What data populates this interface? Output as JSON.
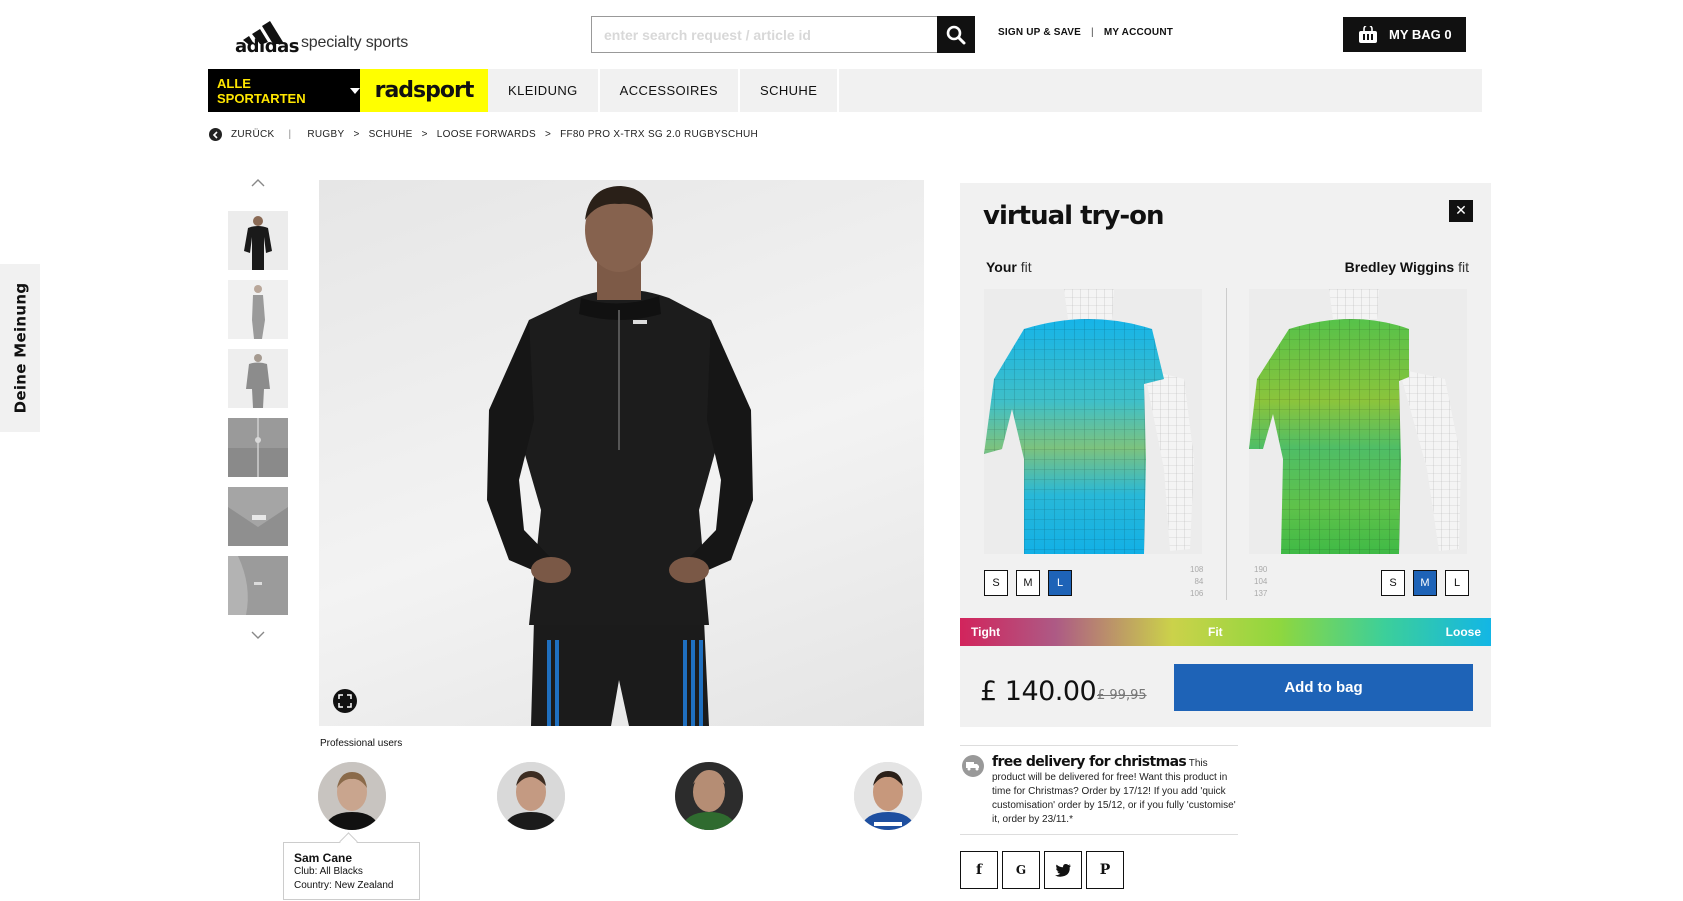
{
  "brand": {
    "logo_word": "adidas",
    "subtitle": "specialty sports"
  },
  "search": {
    "placeholder": "enter search request / article id"
  },
  "top_links": {
    "signup": "SIGN UP & SAVE",
    "separator": "|",
    "account": "MY ACCOUNT"
  },
  "bag": {
    "label": "MY BAG 0"
  },
  "nav": {
    "all_sports": "ALLE SPORTARTEN",
    "sport": "radsport",
    "tabs": [
      "KLEIDUNG",
      "ACCESSOIRES",
      "SCHUHE"
    ]
  },
  "breadcrumb": {
    "back": "ZURÜCK",
    "separator": ">",
    "items": [
      "RUGBY",
      "SCHUHE",
      "LOOSE FORWARDS",
      "FF80 PRO X-TRX SG 2.0 RUGBYSCHUH"
    ]
  },
  "feedback": {
    "label": "Deine Meinung"
  },
  "professional_users": {
    "label": "Professional users",
    "tooltip": {
      "name": "Sam Cane",
      "club": "Club: All Blacks",
      "country": "Country: New Zealand"
    }
  },
  "tryon": {
    "title": "virtual try-on",
    "left_fit": {
      "name": "Your",
      "suffix": "fit"
    },
    "right_fit": {
      "name": "Bredley Wiggins",
      "suffix": "fit"
    },
    "sizes": [
      "S",
      "M",
      "L"
    ],
    "left_selected": "L",
    "right_selected": "M",
    "left_measure": [
      "108",
      "84",
      "106"
    ],
    "right_measure": [
      "190",
      "104",
      "137"
    ],
    "fit_scale": {
      "tight": "Tight",
      "fit": "Fit",
      "loose": "Loose"
    },
    "price": "£ 140.00",
    "old_price": "£ 99,95",
    "add_to_bag": "Add to bag",
    "close": "✕"
  },
  "delivery": {
    "title": "free delivery for christmas",
    "text": "This product will be delivered for free! Want this product in time for Christmas? Order by 17/12! If you add 'quick customisation' order by 15/12, or if you fully 'customise' it, order by 23/11.*"
  },
  "share": {
    "facebook": "f",
    "google": "G",
    "pinterest": "P"
  },
  "colors": {
    "accent_blue": "#1e63b7",
    "nav_yellow": "#ffff00",
    "black": "#111111"
  }
}
